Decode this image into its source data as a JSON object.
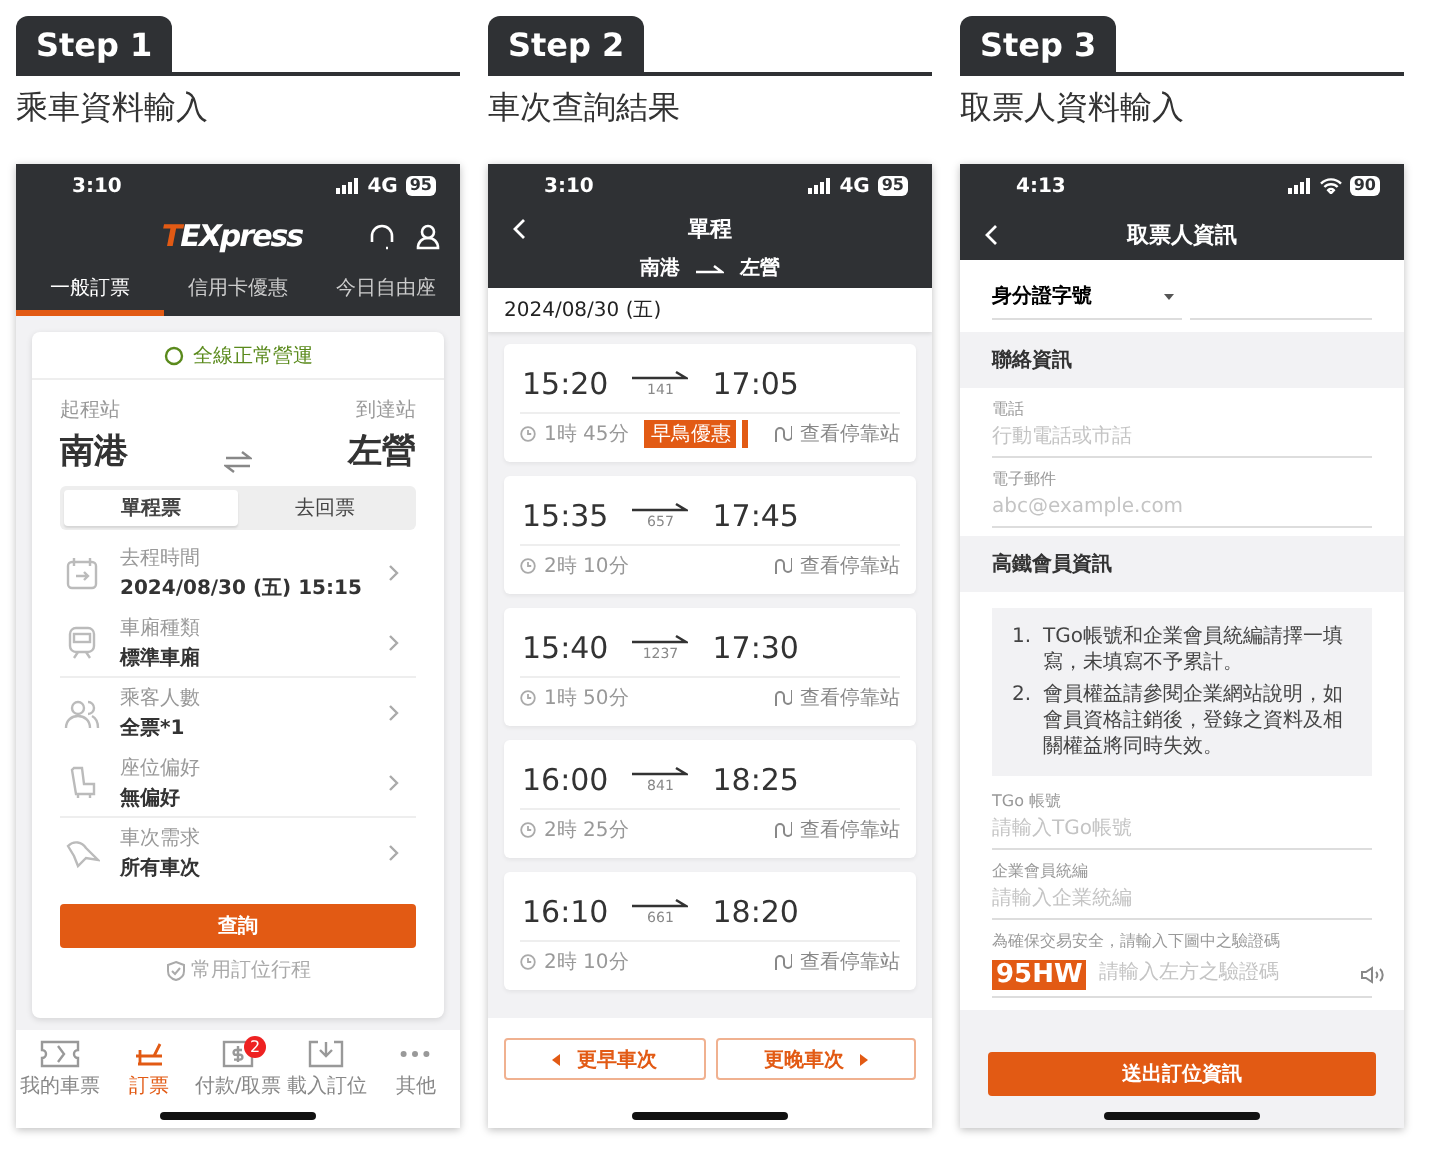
{
  "steps": [
    {
      "label": "Step 1",
      "title": "乘車資料輸入"
    },
    {
      "label": "Step 2",
      "title": "車次查詢結果"
    },
    {
      "label": "Step 3",
      "title": "取票人資料輸入"
    }
  ],
  "booking_screen": {
    "status": {
      "time": "3:10",
      "network": "4G",
      "battery": "95"
    },
    "logo": "TEXpress",
    "tabs": [
      {
        "label": "一般訂票",
        "selected": true
      },
      {
        "label": "信用卡優惠",
        "selected": false
      },
      {
        "label": "今日自由座",
        "selected": false
      }
    ],
    "service_status": "全線正常營運",
    "origin": {
      "label": "起程站",
      "station": "南港"
    },
    "destination": {
      "label": "到達站",
      "station": "左營"
    },
    "trip_types": [
      {
        "label": "單程票",
        "selected": true
      },
      {
        "label": "去回票",
        "selected": false
      }
    ],
    "options": [
      {
        "label": "去程時間",
        "value": "2024/08/30 (五) 15:15"
      },
      {
        "label": "車廂種類",
        "value": "標準車廂"
      },
      {
        "label": "乘客人數",
        "value": "全票*1"
      },
      {
        "label": "座位偏好",
        "value": "無偏好"
      },
      {
        "label": "車次需求",
        "value": "所有車次"
      }
    ],
    "search_button": "查詢",
    "saved_trips_link": "常用訂位行程",
    "nav": [
      {
        "label": "我的車票",
        "selected": false
      },
      {
        "label": "訂票",
        "selected": true
      },
      {
        "label": "付款/取票",
        "selected": false,
        "badge": "2"
      },
      {
        "label": "載入訂位",
        "selected": false
      },
      {
        "label": "其他",
        "selected": false
      }
    ]
  },
  "results_screen": {
    "status": {
      "time": "3:10",
      "network": "4G",
      "battery": "95"
    },
    "title": "單程",
    "from": "南港",
    "to": "左營",
    "date": "2024/08/30 (五)",
    "trains": [
      {
        "departure": "15:20",
        "arrival": "17:05",
        "number": "141",
        "duration": "1時 45分",
        "tag": "早鳥優惠",
        "stops_link": "查看停靠站"
      },
      {
        "departure": "15:35",
        "arrival": "17:45",
        "number": "657",
        "duration": "2時 10分",
        "stops_link": "查看停靠站"
      },
      {
        "departure": "15:40",
        "arrival": "17:30",
        "number": "1237",
        "duration": "1時 50分",
        "stops_link": "查看停靠站"
      },
      {
        "departure": "16:00",
        "arrival": "18:25",
        "number": "841",
        "duration": "2時 25分",
        "stops_link": "查看停靠站"
      },
      {
        "departure": "16:10",
        "arrival": "18:20",
        "number": "661",
        "duration": "2時 10分",
        "stops_link": "查看停靠站"
      }
    ],
    "earlier_button": "更早車次",
    "later_button": "更晚車次"
  },
  "passenger_screen": {
    "status": {
      "time": "4:13",
      "battery": "90"
    },
    "title": "取票人資訊",
    "id_type": "身分證字號",
    "contact_section": "聯絡資訊",
    "contact_fields": [
      {
        "label": "電話",
        "placeholder": "行動電話或市話"
      },
      {
        "label": "電子郵件",
        "placeholder": "abc@example.com"
      }
    ],
    "member_section": "高鐵會員資訊",
    "notes": [
      {
        "number": "1.",
        "text": "TGo帳號和企業會員統編請擇一填寫，未填寫不予累計。"
      },
      {
        "number": "2.",
        "text": "會員權益請參閱企業網站說明，如會員資格註銷後，登錄之資料及相關權益將同時失效。"
      }
    ],
    "member_fields": [
      {
        "label": "TGo 帳號",
        "placeholder": "請輸入TGo帳號"
      },
      {
        "label": "企業會員統編",
        "placeholder": "請輸入企業統編"
      }
    ],
    "captcha_label": "為確保交易安全，請輸入下圖中之驗證碼",
    "captcha_code": "95HW",
    "captcha_placeholder": "請輸入左方之驗證碼",
    "submit_button": "送出訂位資訊"
  }
}
